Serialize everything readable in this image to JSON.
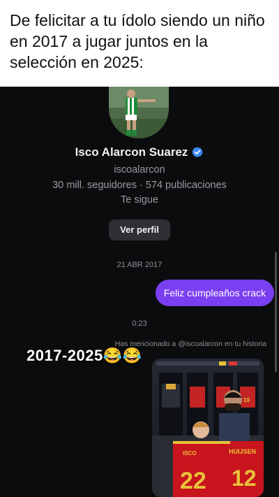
{
  "caption": {
    "text": "De felicitar a tu ídolo siendo un niño en 2017 a jugar juntos en la selección en 2025:"
  },
  "profile": {
    "name": "Isco Alarcon Suarez",
    "username": "iscoalarcon",
    "stats": "30 mill. seguidores · 574 publicaciones",
    "follow_status": "Te sigue",
    "view_profile_label": "Ver perfil",
    "verified": true
  },
  "chat": {
    "date": "21 ABR 2017",
    "sent_message": "Feliz cumpleaños crack",
    "time": "0:23",
    "mention_text": "Has mencionado a @iscoalarcon en tu historia",
    "story_jerseys": [
      "ISCO",
      "HUIJSEN"
    ],
    "story_numbers": [
      "22",
      "12",
      "19"
    ]
  },
  "overlay": {
    "text": "2017-2025😂😂"
  },
  "colors": {
    "bubble": "#7b3ff2",
    "background": "#0b0c0e",
    "verified": "#3d8bfd"
  }
}
